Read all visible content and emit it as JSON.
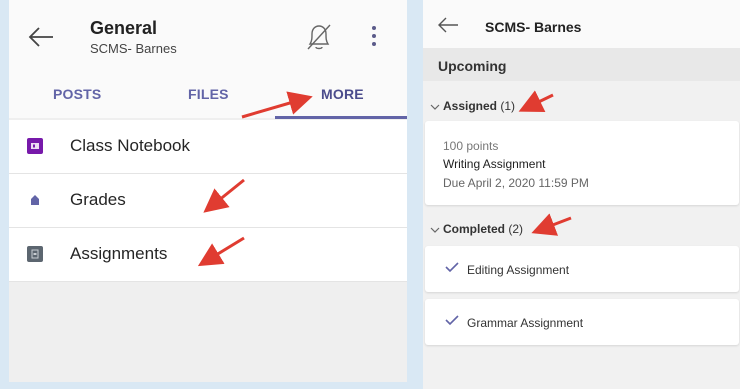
{
  "left": {
    "title": "General",
    "subtitle": "SCMS- Barnes",
    "tabs": [
      {
        "label": "POSTS"
      },
      {
        "label": "FILES"
      },
      {
        "label": "MORE"
      }
    ],
    "items": [
      {
        "label": "Class Notebook",
        "icon": "onenote-icon",
        "icon_color": "#7719aa"
      },
      {
        "label": "Grades",
        "icon": "grades-icon",
        "icon_color": "#6264a7"
      },
      {
        "label": "Assignments",
        "icon": "assignments-icon",
        "icon_color": "#5c6670"
      }
    ]
  },
  "right": {
    "title": "SCMS- Barnes",
    "section_label": "Upcoming",
    "assigned": {
      "label": "Assigned",
      "count": "(1)"
    },
    "assigned_card": {
      "points": "100 points",
      "name": "Writing Assignment",
      "due": "Due April 2, 2020 11:59 PM"
    },
    "completed": {
      "label": "Completed",
      "count": "(2)"
    },
    "completed_items": [
      {
        "label": "Editing Assignment"
      },
      {
        "label": "Grammar Assignment"
      }
    ]
  },
  "colors": {
    "accent": "#6264a7",
    "annotation_arrow": "#e03c31"
  }
}
